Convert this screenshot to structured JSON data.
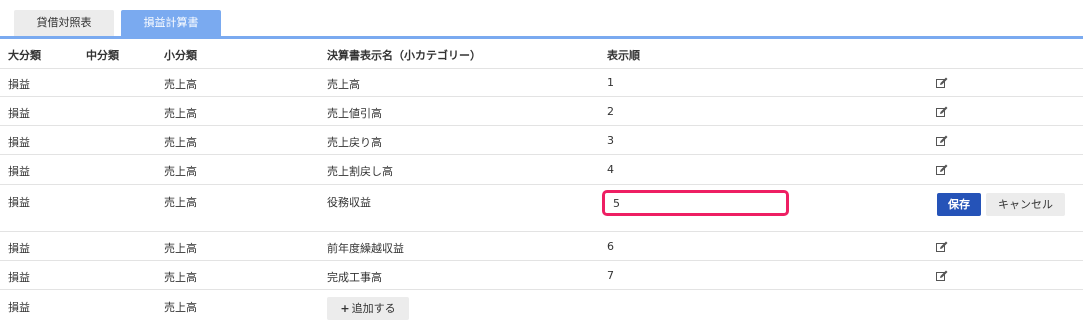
{
  "tabs": [
    {
      "label": "貸借対照表",
      "active": false
    },
    {
      "label": "損益計算書",
      "active": true
    }
  ],
  "table": {
    "headers": {
      "major": "大分類",
      "mid": "中分類",
      "minor": "小分類",
      "name": "決算書表示名（小カテゴリー）",
      "order": "表示順"
    },
    "rows": [
      {
        "major": "損益",
        "mid": "",
        "minor": "売上高",
        "name": "売上高",
        "order": "1"
      },
      {
        "major": "損益",
        "mid": "",
        "minor": "売上高",
        "name": "売上値引高",
        "order": "2"
      },
      {
        "major": "損益",
        "mid": "",
        "minor": "売上高",
        "name": "売上戻り高",
        "order": "3"
      },
      {
        "major": "損益",
        "mid": "",
        "minor": "売上高",
        "name": "売上割戻し高",
        "order": "4"
      },
      {
        "major": "損益",
        "mid": "",
        "minor": "売上高",
        "name": "役務収益",
        "order": "5",
        "editing": true
      },
      {
        "major": "損益",
        "mid": "",
        "minor": "売上高",
        "name": "前年度繰越収益",
        "order": "6"
      },
      {
        "major": "損益",
        "mid": "",
        "minor": "売上高",
        "name": "完成工事高",
        "order": "7"
      }
    ],
    "add_row": {
      "major": "損益",
      "minor": "売上高"
    }
  },
  "buttons": {
    "save": "保存",
    "cancel": "キャンセル",
    "add": "追加する"
  },
  "icons": {
    "edit": "edit-icon",
    "plus": "plus-icon"
  },
  "colors": {
    "accent": "#7aaaf0",
    "save": "#2553b8",
    "highlight": "#ee1f63"
  }
}
